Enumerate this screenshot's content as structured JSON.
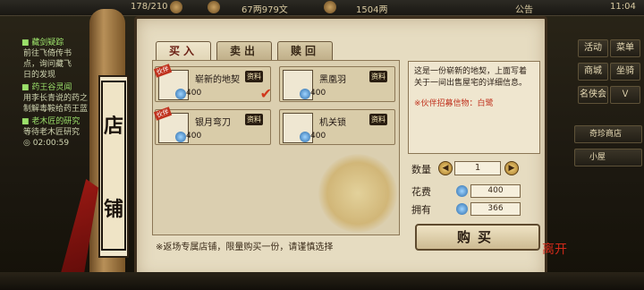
{
  "topbar": {
    "exp": "178/210",
    "money": "67两979文",
    "ingot": "1504两",
    "notice": "公告",
    "time": "11:04"
  },
  "quests": [
    {
      "title": "■ 藏剑疑踪",
      "lines": [
        "前往飞倚传书",
        "点，询问藏飞",
        "日的发现"
      ]
    },
    {
      "title": "■ 药王谷灵闻",
      "lines": [
        "用李长青说的药之",
        "制解毒鞍给药王蓝"
      ]
    },
    {
      "title": "■ 老木匠的研究",
      "lines": [
        "等待老木匠研究",
        "◎ 02:00:59"
      ]
    }
  ],
  "right_menu": {
    "activity": "活动",
    "daily": "菜单",
    "shop": "商城",
    "mount": "坐骑",
    "award": "名侠会",
    "newbie": "Ｖ",
    "strange_shop": "奇珍商店",
    "small": "小屋"
  },
  "scroll": {
    "char1": "店",
    "char2": "铺"
  },
  "tabs": [
    "买入",
    "卖出",
    "赎回"
  ],
  "items": [
    {
      "name": "崭新的地契",
      "tag": "资料",
      "badge": "伙伴",
      "price": "400",
      "selected": true,
      "icon": "scroll-deed-icon"
    },
    {
      "name": "黑凰羽",
      "tag": "资料",
      "badge": "",
      "price": "400",
      "selected": false,
      "icon": "black-feather-icon"
    },
    {
      "name": "银月弯刀",
      "tag": "资料",
      "badge": "伙伴",
      "price": "400",
      "selected": false,
      "icon": "curved-sword-icon"
    },
    {
      "name": "机关锁",
      "tag": "资料",
      "badge": "",
      "price": "400",
      "selected": false,
      "icon": "mechanism-lock-icon"
    }
  ],
  "footnote": "※返场专属店铺，限量购买一份，请谨慎选择",
  "detail": {
    "description": "这是一份崭新的地契，上面写着关于一间出售屋宅的详细信息。",
    "bonus": "※伙伴招募信物：白鹭"
  },
  "purchase": {
    "qty_label": "数量",
    "qty": "1",
    "cost_label": "花费",
    "cost": "400",
    "own_label": "拥有",
    "own": "366",
    "buy_label": "购买"
  },
  "corner": "离开",
  "colors": {
    "accent": "#c0321e",
    "panel": "#e6dcc1",
    "frame": "#3c2e1d"
  }
}
